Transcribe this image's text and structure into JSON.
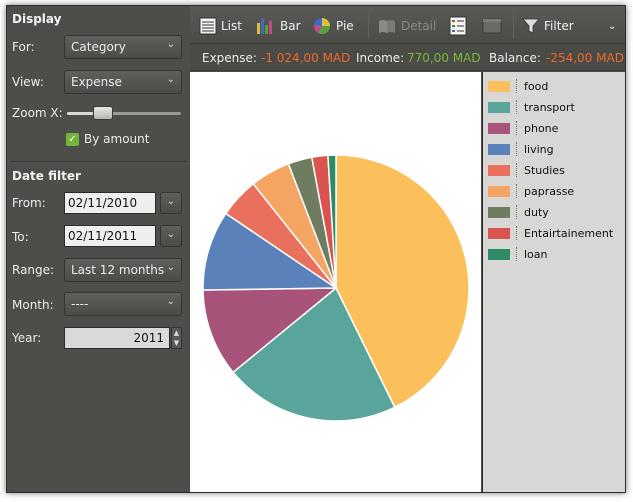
{
  "display": {
    "title": "Display",
    "for_label": "For:",
    "for_value": "Category",
    "view_label": "View:",
    "view_value": "Expense",
    "zoom_label": "Zoom X:",
    "by_amount_label": "By amount",
    "by_amount_checked": true,
    "zoom_level": 0.2
  },
  "date_filter": {
    "title": "Date filter",
    "from_label": "From:",
    "from_value": "02/11/2010",
    "to_label": "To:",
    "to_value": "02/11/2011",
    "range_label": "Range:",
    "range_value": "Last 12 months",
    "month_label": "Month:",
    "month_value": "----",
    "year_label": "Year:",
    "year_value": "2011"
  },
  "toolbar": {
    "list_label": "List",
    "bar_label": "Bar",
    "pie_label": "Pie",
    "detail_label": "Detail",
    "filter_label": "Filter"
  },
  "summary": {
    "expense_label": "Expense:",
    "expense_value": "-1 024,00 MAD",
    "income_label": "Income:",
    "income_value": "770,00 MAD",
    "balance_label": "Balance:",
    "balance_value": "-254,00 MAD"
  },
  "colors": {
    "negative": "#ef6a2a",
    "positive": "#79b83a"
  },
  "chart_data": {
    "type": "pie",
    "categories": [
      "food",
      "transport",
      "phone",
      "living",
      "Studies",
      "paprasse",
      "duty",
      "Entairtainement",
      "loan"
    ],
    "values": [
      44,
      22,
      11,
      10,
      5,
      5,
      3,
      2,
      1
    ],
    "colors": [
      "#fbbf5b",
      "#5aa59b",
      "#a8547a",
      "#5b81ba",
      "#e8705c",
      "#f4a463",
      "#6e7c5f",
      "#d9534f",
      "#2e8b66"
    ],
    "legend": "right"
  }
}
